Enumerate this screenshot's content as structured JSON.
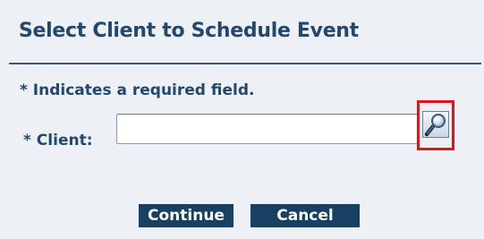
{
  "dialog": {
    "title": "Select Client to Schedule Event",
    "required_note": "* Indicates a required field.",
    "client_label": "* Client:",
    "client_value": "",
    "client_placeholder": "",
    "search_icon": "magnifier-icon",
    "continue_label": "Continue",
    "cancel_label": "Cancel"
  },
  "colors": {
    "title_text": "#23476d",
    "rule": "#2e5c82",
    "button_bg": "#184062",
    "highlight": "#e0141b",
    "background": "#edf1f5"
  }
}
